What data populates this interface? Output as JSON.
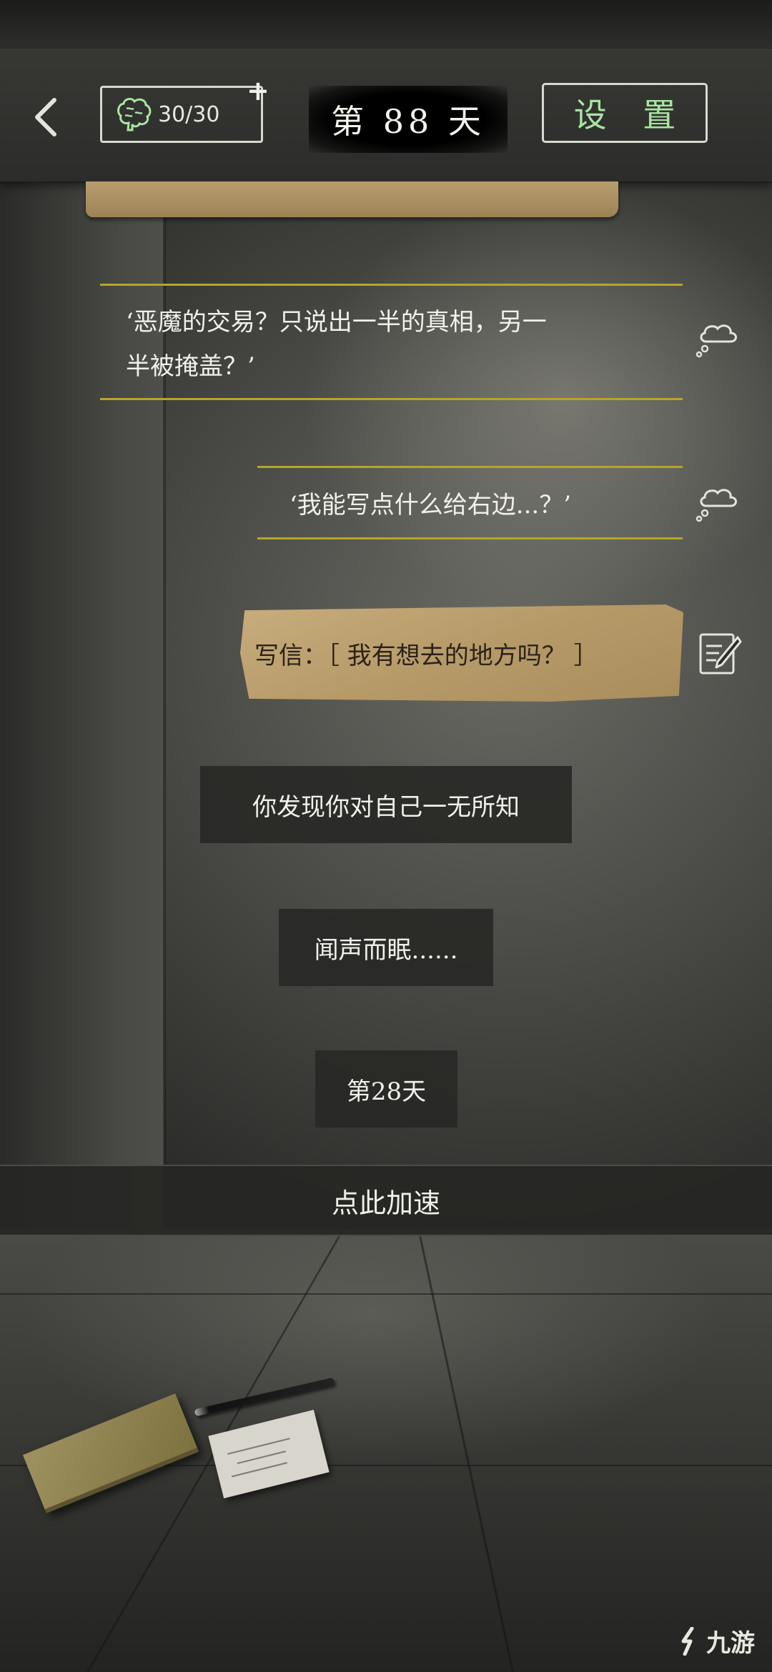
{
  "header": {
    "brain_value": "30/30",
    "plus_symbol": "+",
    "day_label": "第 88 天",
    "settings_label": "设 置"
  },
  "messages": {
    "thought1_line1": "‘恶魔的交易？只说出一半的真相，另一",
    "thought1_line2": "半被掩盖？’",
    "thought2": "‘我能写点什么给右边...？’",
    "letter": "写信：［ 我有想去的地方吗？ ］"
  },
  "narration": {
    "n1": "你发现你对自己一无所知",
    "n2": "闻声而眠......",
    "n3": "第28天"
  },
  "speed_up_label": "点此加速",
  "watermark": "九游",
  "colors": {
    "settings_text": "#a9e5a1",
    "thought_line": "#b7a52a",
    "letter_paper": "#b69a68"
  },
  "icons": [
    "back-arrow-icon",
    "brain-icon",
    "plus-icon",
    "thought-cloud-icon",
    "write-letter-icon"
  ]
}
